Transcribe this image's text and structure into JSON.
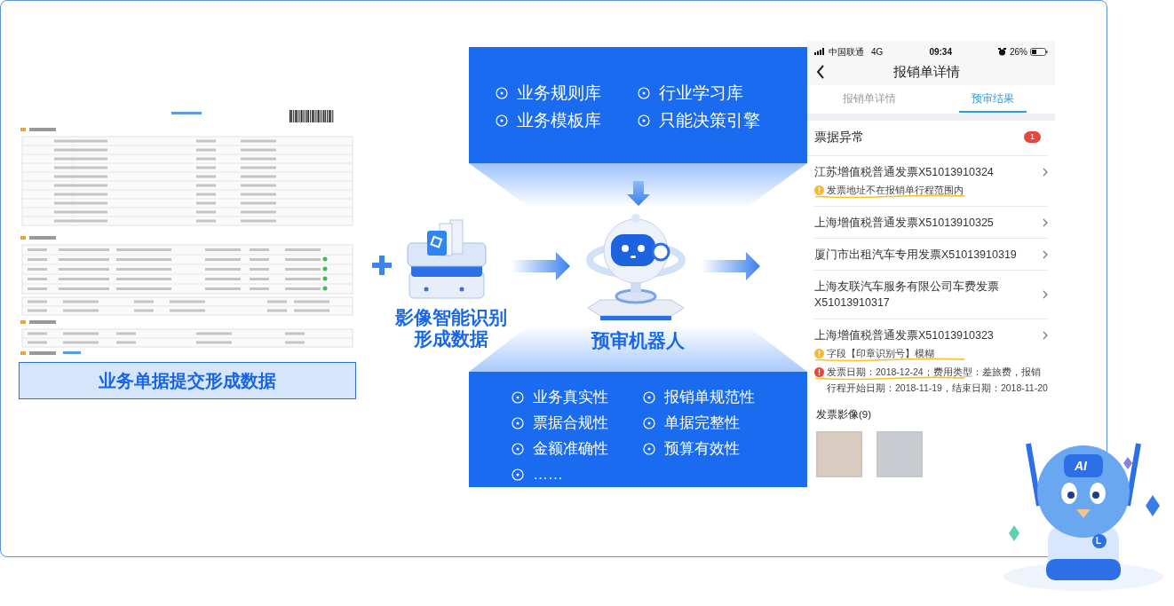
{
  "document": {
    "caption": "业务单据提交形成数据"
  },
  "recognition": {
    "caption_lines": [
      "影像智能识别",
      "形成数据"
    ]
  },
  "knowledge_base": {
    "items": [
      "业务规则库",
      "行业学习库",
      "业务模板库",
      "只能决策引擎"
    ]
  },
  "robot": {
    "caption": "预审机器人"
  },
  "checks": {
    "items": [
      "业务真实性",
      "报销单规范性",
      "票据合规性",
      "单据完整性",
      "金额准确性",
      "预算有效性",
      "……"
    ]
  },
  "phone": {
    "status_bar": {
      "carrier": "中国联通",
      "network": "4G",
      "time": "09:34",
      "battery": "26%"
    },
    "title": "报销单详情",
    "tabs": [
      {
        "label": "报销单详情",
        "selected": false
      },
      {
        "label": "预审结果",
        "selected": true
      }
    ],
    "section": {
      "title": "票据异常",
      "badge": "1"
    },
    "invoices": [
      {
        "title": "江苏增值税普通发票X51013910324",
        "warnings": [
          {
            "text": "发票地址不在报销单行程范围内",
            "color": "#f5b82e",
            "underlined": true
          }
        ]
      },
      {
        "title": "上海增值税普通发票X51013910325"
      },
      {
        "title": "厦门市出租汽车专用发票X51013910319"
      },
      {
        "title": "上海友联汽车服务有限公司车费发票X51013910317"
      },
      {
        "title": "上海增值税普通发票X51013910323",
        "warnings": [
          {
            "text": "字段【印章识别号】模糊",
            "color": "#f5b82e",
            "underlined": true
          },
          {
            "text": "发票日期：2018-12-24；费用类型：差旅费，报销行程开始日期：2018-11-19，结束日期：2018-11-20",
            "color": "#e8453c",
            "underlined": true
          }
        ]
      }
    ],
    "images": {
      "title": "发票影像(9)",
      "thumbnails": [
        {
          "kind": "invoice"
        },
        {
          "kind": "receipt"
        }
      ]
    }
  },
  "mascot": {
    "head_label": "AI",
    "badge_label": "L"
  }
}
